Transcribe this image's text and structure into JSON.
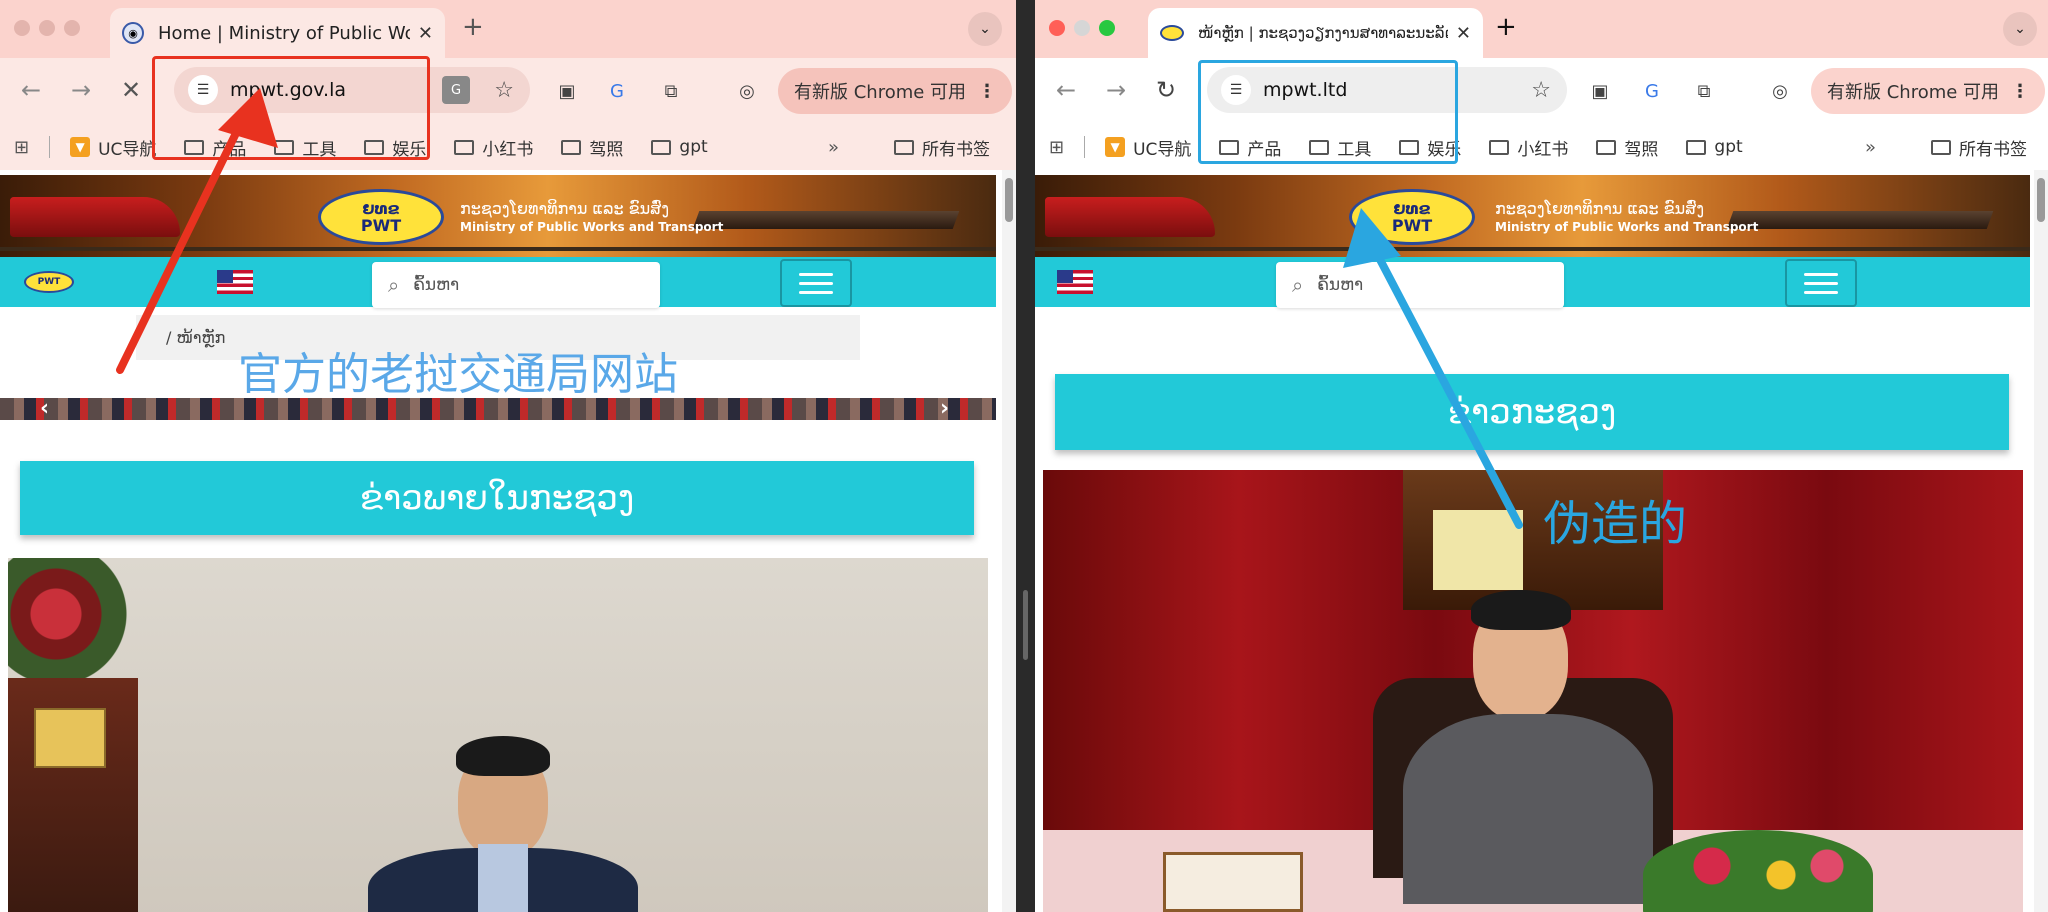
{
  "left": {
    "tab_title": "Home | Ministry of Public Wor",
    "url": "mpwt.gov.la",
    "update_label": "有新版 Chrome 可用",
    "bookmarks": [
      "UC导航",
      "产品",
      "工具",
      "娱乐",
      "小红书",
      "驾照",
      "gpt"
    ],
    "all_bookmarks": "所有书签",
    "ministry_lao": "ກະຊວງໂຍທາທິການ ແລະ ຂົນສົ່ງ",
    "ministry_en": "Ministry of Public Works and Transport",
    "logo_line1": "ຍທຂ",
    "logo_line2": "PWT",
    "search_placeholder": "ຄົ້ນຫາ",
    "breadcrumb": "/  ໜ້າຫຼັກ",
    "section_heading": "ຂ່າວພາຍໃນກະຊວງ",
    "annotation": "官方的老挝交通局网站",
    "annotation_color": "#e8321f"
  },
  "right": {
    "tab_title": "ໜ້າຫຼັກ | ກະຊວງວຽກງານສາທາລະນະລັດ",
    "url": "mpwt.ltd",
    "update_label": "有新版 Chrome 可用",
    "bookmarks": [
      "UC导航",
      "产品",
      "工具",
      "娱乐",
      "小红书",
      "驾照",
      "gpt"
    ],
    "all_bookmarks": "所有书签",
    "ministry_lao": "ກະຊວງໂຍທາທິການ ແລະ ຂົນສົ່ງ",
    "ministry_en": "Ministry of Public Works and Transport",
    "logo_line1": "ຍທຂ",
    "logo_line2": "PWT",
    "search_placeholder": "ຄົ້ນຫາ",
    "section_heading": "ຂ່າວກະຊວງ",
    "annotation": "伪造的",
    "annotation_color": "#2aa6e0"
  },
  "colors": {
    "left_chrome": "#fbd3cd",
    "right_chrome": "#fbd3cd",
    "site_cyan": "#22c9d8"
  }
}
